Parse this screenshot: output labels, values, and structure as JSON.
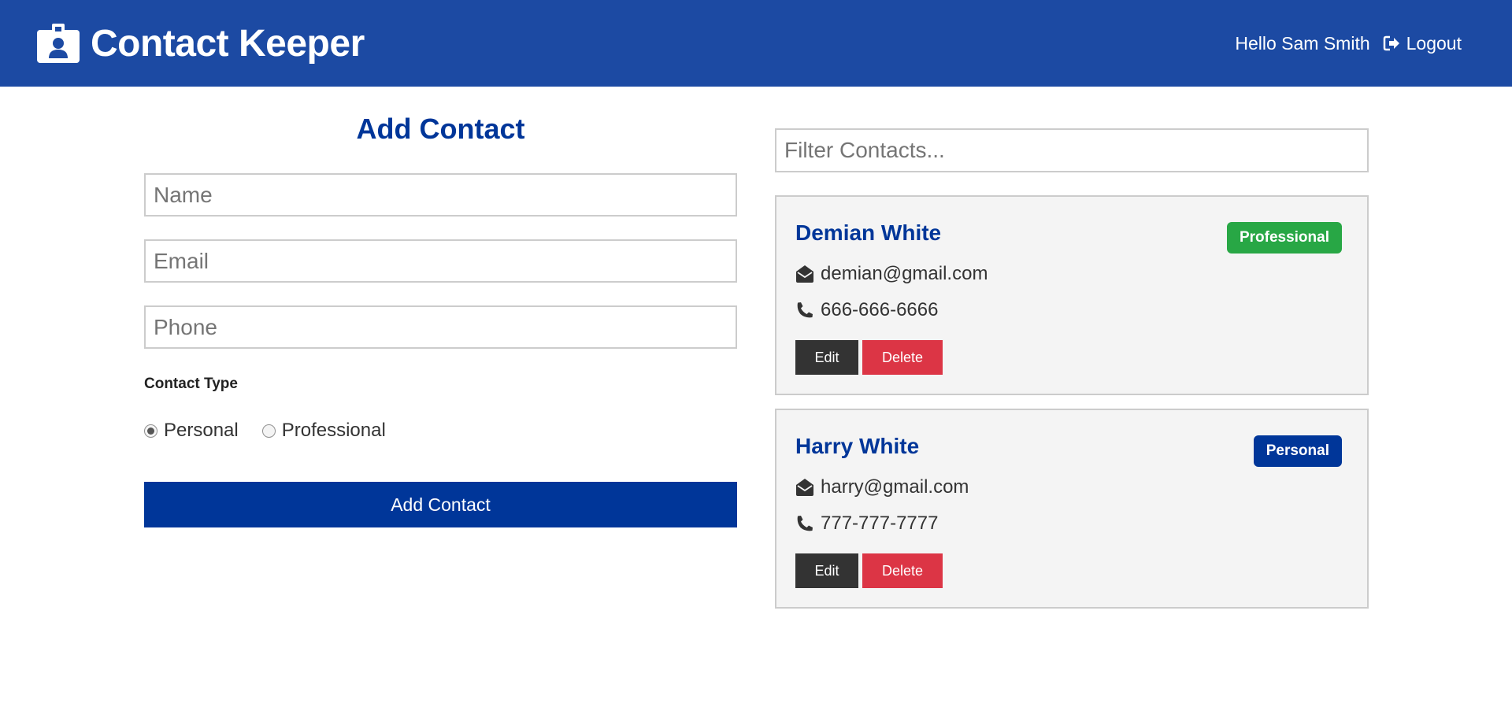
{
  "app": {
    "title": "Contact Keeper",
    "brand_color": "#1c4aa3",
    "icon": "id-badge-icon"
  },
  "nav": {
    "greeting": "Hello Sam Smith",
    "logout_label": "Logout",
    "logout_icon": "sign-out-icon"
  },
  "form": {
    "title": "Add Contact",
    "name_placeholder": "Name",
    "email_placeholder": "Email",
    "phone_placeholder": "Phone",
    "contact_type_label": "Contact Type",
    "type_options": [
      {
        "label": "Personal",
        "checked": true
      },
      {
        "label": "Professional",
        "checked": false
      }
    ],
    "submit_label": "Add Contact"
  },
  "filter": {
    "placeholder": "Filter Contacts..."
  },
  "contacts": [
    {
      "name": "Demian White",
      "type": "Professional",
      "type_color": "#28a745",
      "email": "demian@gmail.com",
      "phone": "666-666-6666",
      "edit_label": "Edit",
      "delete_label": "Delete"
    },
    {
      "name": "Harry White",
      "type": "Personal",
      "type_color": "#003699",
      "email": "harry@gmail.com",
      "phone": "777-777-7777",
      "edit_label": "Edit",
      "delete_label": "Delete"
    }
  ],
  "colors": {
    "primary": "#003699",
    "danger": "#dc3545",
    "dark": "#333333",
    "success": "#28a745"
  }
}
